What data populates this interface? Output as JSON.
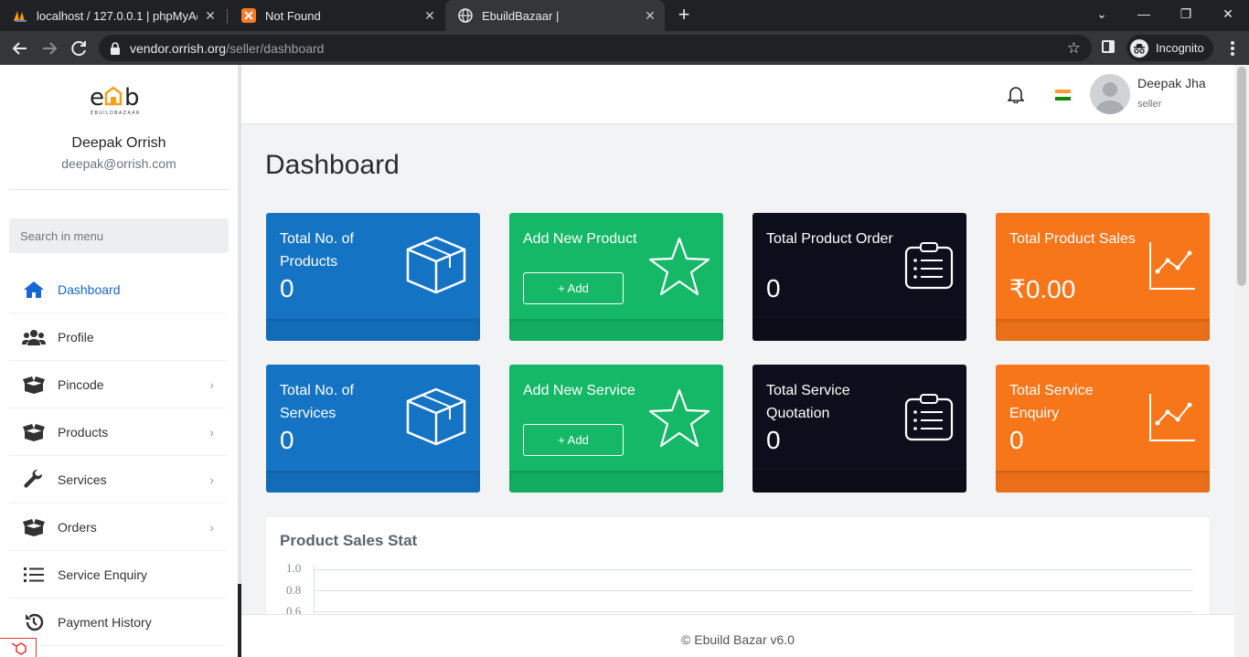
{
  "browser": {
    "tabs": [
      {
        "title": "localhost / 127.0.0.1 | phpMyAdmin",
        "close": "✕"
      },
      {
        "title": "Not Found",
        "close": "✕"
      },
      {
        "title": "EbuildBazaar |",
        "close": "✕"
      }
    ],
    "new_tab": "+",
    "window_controls": {
      "dropdown": "⌄",
      "minimize": "—",
      "restore": "❐",
      "close": "✕"
    },
    "url_host": "vendor.orrish.org",
    "url_path": "/seller/dashboard",
    "incognito_label": "Incognito"
  },
  "sidebar": {
    "logo_text": "EBUILDBAZAAR",
    "user_name": "Deepak Orrish",
    "user_email": "deepak@orrish.com",
    "search_placeholder": "Search in menu",
    "items": [
      {
        "label": "Dashboard",
        "icon": "home-icon",
        "active": true
      },
      {
        "label": "Profile",
        "icon": "users-icon"
      },
      {
        "label": "Pincode",
        "icon": "box-open-icon",
        "chevron": "›"
      },
      {
        "label": "Products",
        "icon": "box-open-icon",
        "chevron": "›"
      },
      {
        "label": "Services",
        "icon": "wrench-icon",
        "chevron": "›"
      },
      {
        "label": "Orders",
        "icon": "box-open-icon",
        "chevron": "›"
      },
      {
        "label": "Service Enquiry",
        "icon": "list-icon"
      },
      {
        "label": "Payment History",
        "icon": "history-icon"
      }
    ]
  },
  "topbar": {
    "user_name": "Deepak Jha",
    "user_role": "seller"
  },
  "page": {
    "title": "Dashboard"
  },
  "cards": [
    {
      "title": "Total No. of Products",
      "value": "0",
      "color": "#1573c4",
      "icon": "box-icon"
    },
    {
      "title": "Add New Product",
      "button": "+ Add",
      "color": "#14b866",
      "icon": "star-icon"
    },
    {
      "title": "Total Product Order",
      "value": "0",
      "color": "#0c0f1b",
      "icon": "clipboard-list-icon"
    },
    {
      "title": "Total Product Sales",
      "value": "₹0.00",
      "color": "#f8761a",
      "icon": "line-chart-icon"
    },
    {
      "title": "Total No. of Services",
      "value": "0",
      "color": "#1573c4",
      "icon": "box-icon"
    },
    {
      "title": "Add New Service",
      "button": "+ Add",
      "color": "#14b866",
      "icon": "star-icon"
    },
    {
      "title": "Total Service Quotation",
      "value": "0",
      "color": "#0c0f1b",
      "icon": "clipboard-list-icon"
    },
    {
      "title": "Total Service Enquiry",
      "value": "0",
      "color": "#f8761a",
      "icon": "line-chart-icon"
    }
  ],
  "chart_panel": {
    "title": "Product Sales Stat",
    "y_ticks": [
      "1.0",
      "0.8",
      "0.6"
    ]
  },
  "footer": {
    "text": "© Ebuild Bazar v6.0"
  }
}
